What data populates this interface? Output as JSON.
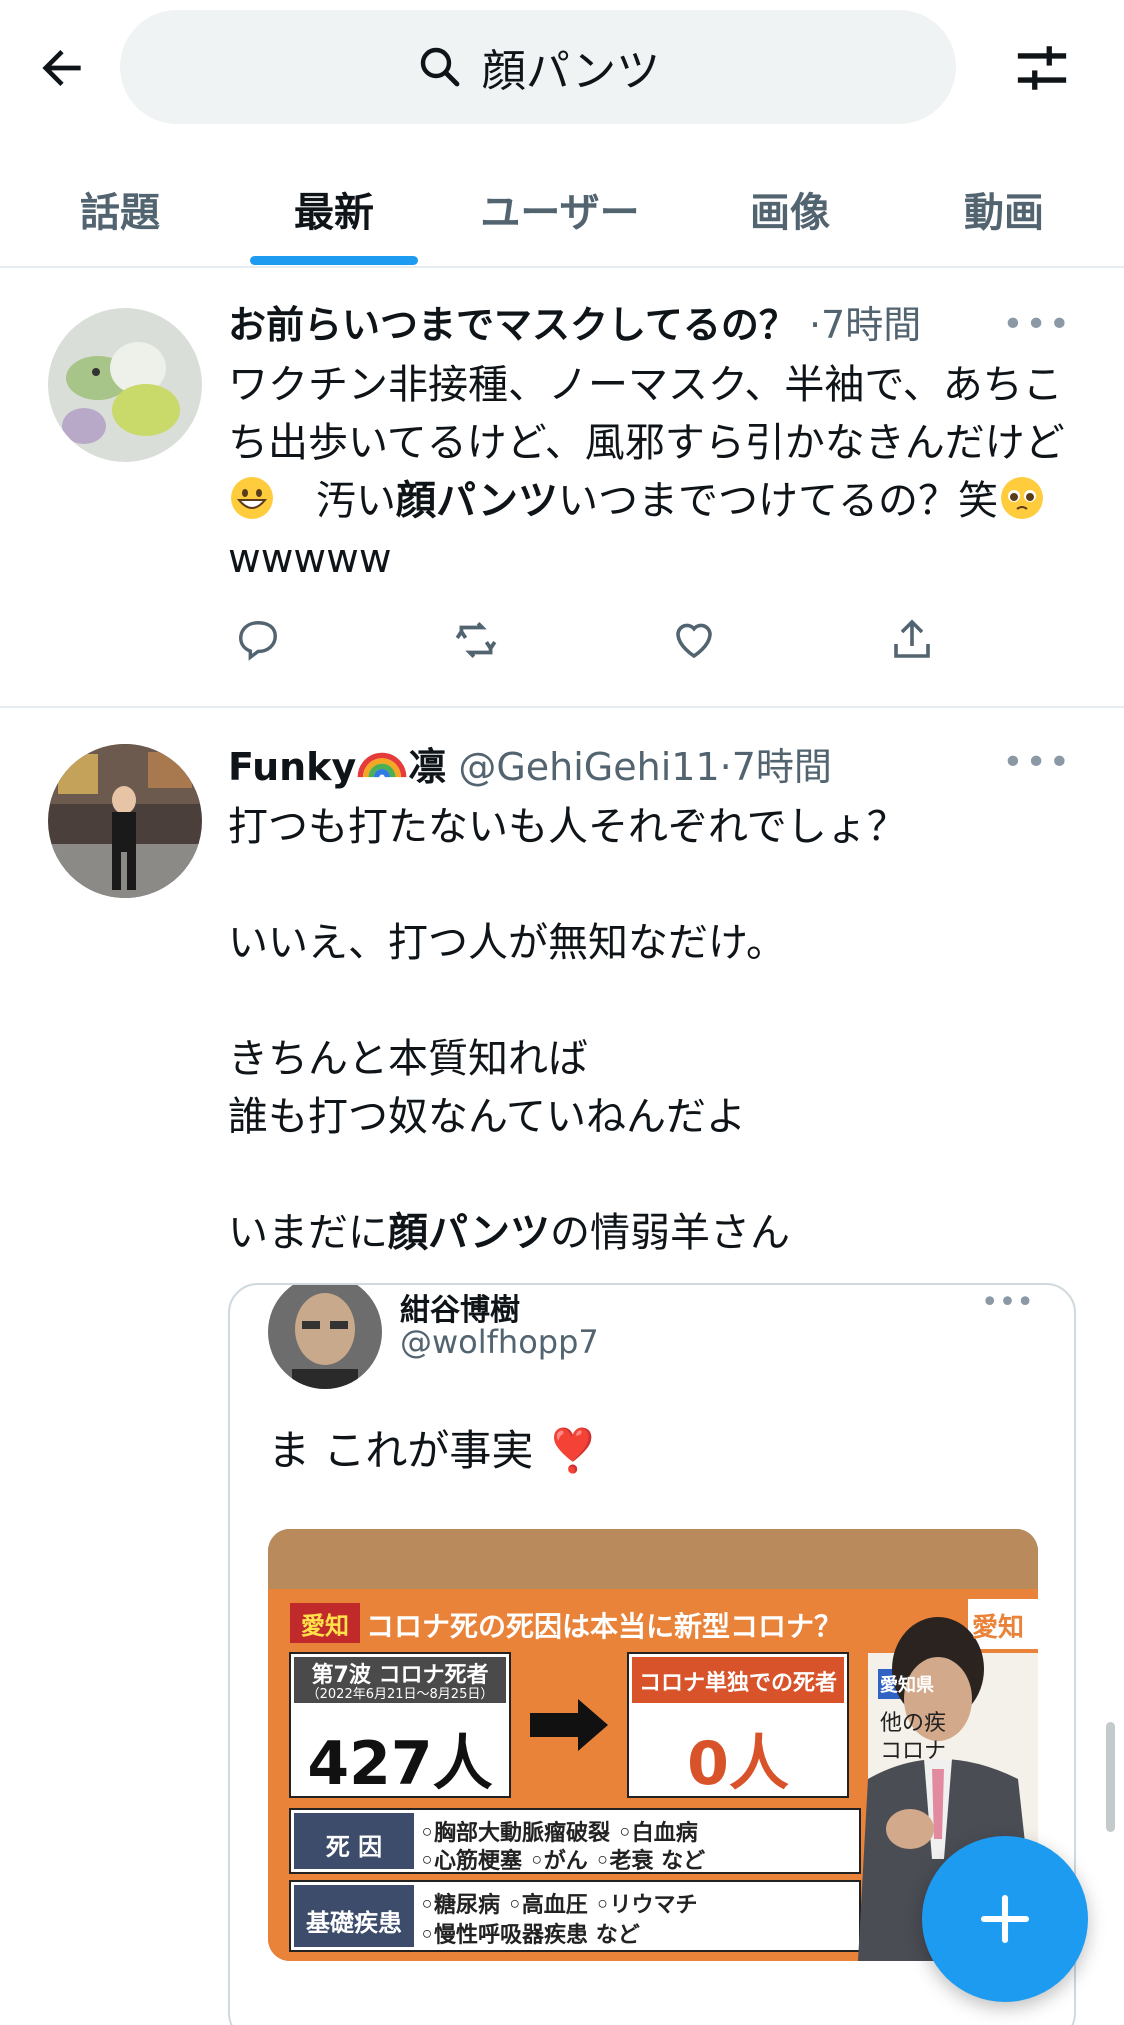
{
  "header": {
    "search_query": "顔パンツ",
    "back_icon": "arrow-left-icon",
    "search_icon": "search-icon",
    "filter_icon": "sliders-icon"
  },
  "tabs": [
    {
      "label": "話題"
    },
    {
      "label": "最新"
    },
    {
      "label": "ユーザー"
    },
    {
      "label": "画像"
    },
    {
      "label": "動画"
    }
  ],
  "active_tab": "最新",
  "tweets": [
    {
      "name": "お前らいつまでマスクしてるの？",
      "handle": "",
      "time": "·7時間",
      "text_parts": {
        "a": "ワクチン非接種、ノーマスク、半袖で、あちこち出歩いてるけど、風邪すら引かなきんだけど",
        "b": "　汚い",
        "bold": "顔パンツ",
        "c": "いつまでつけてるの？笑",
        "d": "wwwww"
      }
    },
    {
      "name": "Funky",
      "name_suffix": "凛",
      "handle": "@GehiGehi11",
      "time": "·7時間",
      "lines": {
        "l1": "打つも打たないも人それぞれでしょ？",
        "l2": "いいえ、打つ人が無知なだけ。",
        "l3": "きちんと本質知れば",
        "l4": "誰も打つ奴なんていねんだよ",
        "l5a": "いまだに",
        "l5bold": "顔パンツ",
        "l5c": "の情弱羊さん"
      },
      "quote": {
        "name": "紺谷博樹",
        "handle": "@wolfhopp7",
        "text": "ま これが事実 ❣️",
        "media": {
          "tag": "愛知",
          "headline": "コロナ死の死因は本当に新型コロナ？",
          "side_tag": "愛知",
          "box1_title": "第7波 コロナ死者",
          "box1_dates": "（2022年6月21日〜8月25日）",
          "box1_value": "427人",
          "box2_title": "コロナ単独での死者",
          "box2_value": "0人",
          "row1_label": "死 因",
          "row1_text_a": "◦胸部大動脈瘤破裂 ◦白血病",
          "row1_text_b": "◦心筋梗塞 ◦がん ◦老衰 など",
          "row2_label": "基礎疾患",
          "row2_text_a": "◦糖尿病 ◦高血圧 ◦リウマチ",
          "row2_text_b": "◦慢性呼吸器疾患 など",
          "side_a": "愛知県",
          "side_b": "他の疾",
          "side_c": "コロナ"
        }
      }
    }
  ],
  "colors": {
    "accent": "#1d9bf0",
    "text": "#0f1419",
    "secondary": "#536471"
  }
}
